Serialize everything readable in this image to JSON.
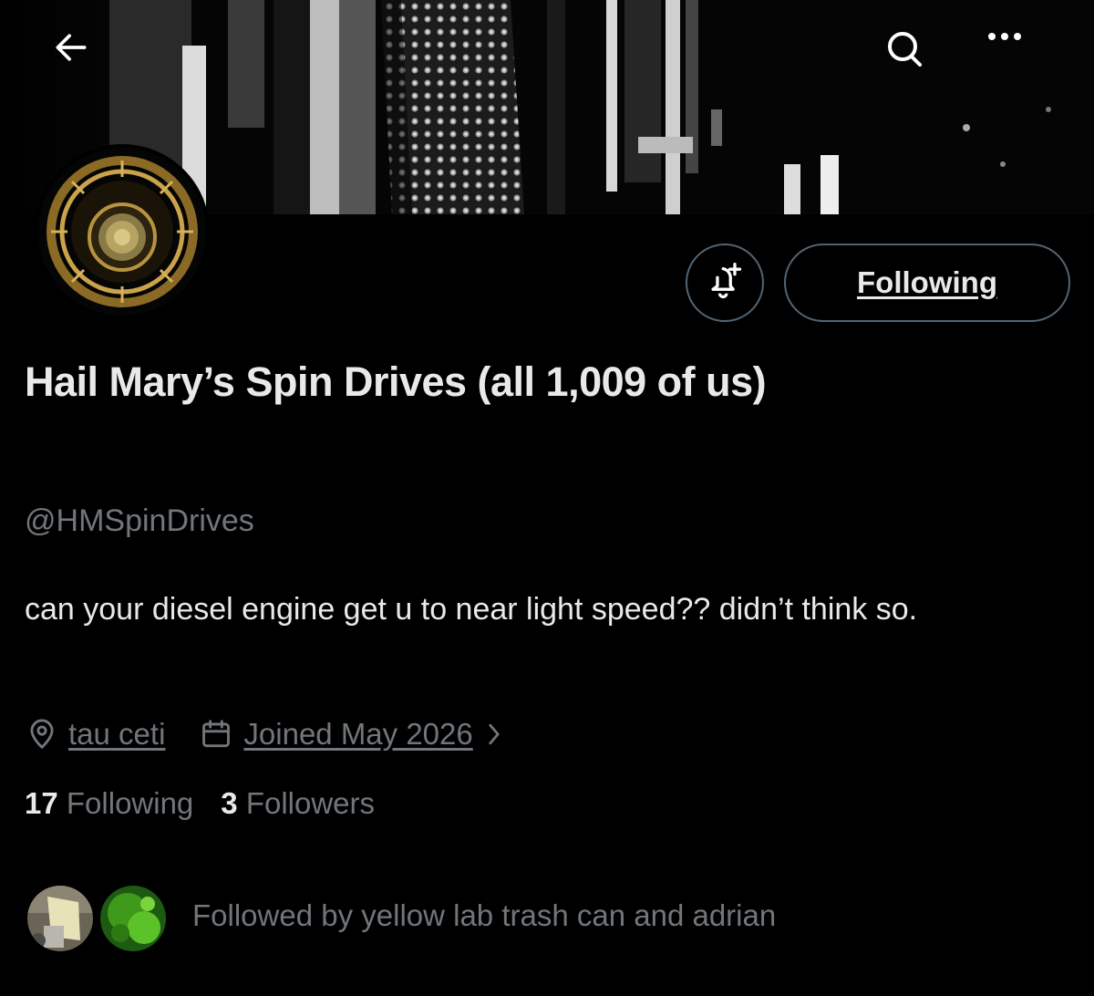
{
  "header": {
    "back_icon": "arrow-left-icon",
    "search_icon": "search-icon",
    "more_icon": "more-horizontal-icon"
  },
  "profile": {
    "display_name": "Hail Mary’s Spin Drives (all 1,009 of us)",
    "handle": "@HMSpinDrives",
    "bio": "can your diesel engine get u to near light speed?? didn’t think so.",
    "location": "tau ceti",
    "joined": "Joined May 2026"
  },
  "actions": {
    "notify_icon": "bell-plus-icon",
    "following_label": "Following"
  },
  "stats": {
    "following_count": "17",
    "following_label": "Following",
    "followers_count": "3",
    "followers_label": "Followers"
  },
  "followed_by": {
    "text": "Followed by yellow lab trash can and adrian"
  },
  "colors": {
    "background": "#000000",
    "primary_text": "#e7e9ea",
    "secondary_text": "#71767b",
    "border": "#536471"
  }
}
